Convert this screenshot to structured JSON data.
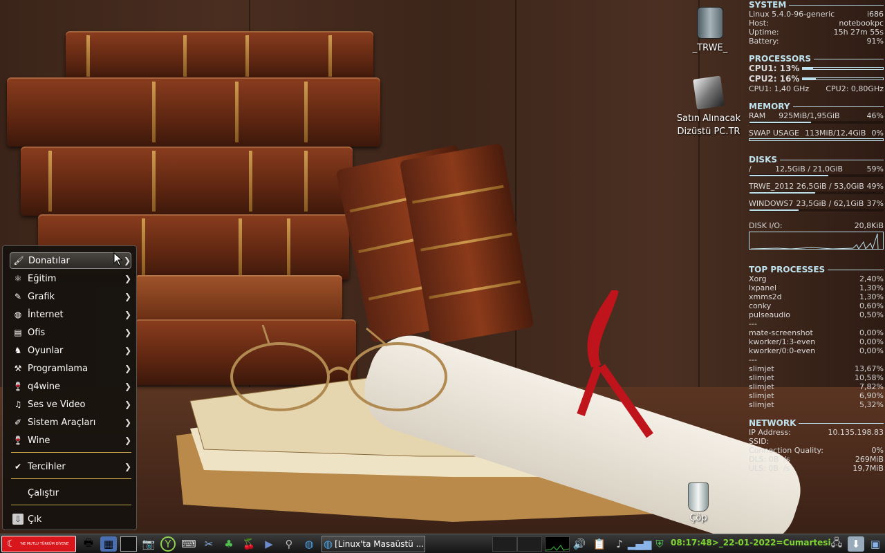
{
  "desktop": {
    "icons": [
      {
        "label": "_TRWE_",
        "icon": "drive-icon"
      },
      {
        "label": "Satın Alınacak\nDizüstü PC.TR",
        "icon": "folder-docs-icon"
      },
      {
        "label": "Çöp",
        "icon": "trash-icon"
      }
    ]
  },
  "conky": {
    "system": {
      "title": "SYSTEM",
      "kernel": "Linux 5.4.0-96-generic",
      "arch": "i686",
      "host_label": "Host:",
      "host": "notebookpc",
      "uptime_label": "Uptime:",
      "uptime": "15h 27m 55s",
      "battery_label": "Battery:",
      "battery": "91%"
    },
    "processors": {
      "title": "PROCESSORS",
      "cpu1": "CPU1: 13%",
      "cpu1_pct": 13,
      "cpu2": "CPU2: 16%",
      "cpu2_pct": 16,
      "freq1": "CPU1: 1,40 GHz",
      "freq2": "CPU2: 0,80GHz"
    },
    "memory": {
      "title": "MEMORY",
      "ram_label": "RAM",
      "ram": "925MiB/1,95GiB",
      "ram_pct_text": "46%",
      "ram_pct": 46,
      "swap_label": "SWAP USAGE",
      "swap": "113MiB/12,4GiB",
      "swap_pct_text": "0%",
      "swap_pct": 0
    },
    "disks": {
      "title": "DISKS",
      "items": [
        {
          "name": "/",
          "usage": "12,5GiB / 21,0GiB",
          "pct_text": "59%",
          "pct": 59
        },
        {
          "name": "TRWE_2012",
          "usage": "26,5GiB / 53,0GiB",
          "pct_text": "49%",
          "pct": 49
        },
        {
          "name": "WINDOWS7",
          "usage": "23,5GiB / 62,1GiB",
          "pct_text": "37%",
          "pct": 37
        }
      ],
      "io_label": "DISK I/O:",
      "io": "20,8KiB"
    },
    "top": {
      "title": "TOP PROCESSES",
      "cpu": [
        {
          "name": "Xorg",
          "val": "2,40%"
        },
        {
          "name": "lxpanel",
          "val": "1,30%"
        },
        {
          "name": "xmms2d",
          "val": "1,30%"
        },
        {
          "name": "conky",
          "val": "0,60%"
        },
        {
          "name": "pulseaudio",
          "val": "0,50%"
        }
      ],
      "sep": "---",
      "io": [
        {
          "name": "mate-screenshot",
          "val": "0,00%"
        },
        {
          "name": "kworker/1:3-even",
          "val": "0,00%"
        },
        {
          "name": "kworker/0:0-even",
          "val": "0,00%"
        }
      ],
      "mem": [
        {
          "name": "slimjet",
          "val": "13,67%"
        },
        {
          "name": "slimjet",
          "val": "10,58%"
        },
        {
          "name": "slimjet",
          "val": "7,82%"
        },
        {
          "name": "slimjet",
          "val": "6,90%"
        },
        {
          "name": "slimjet",
          "val": "5,32%"
        }
      ]
    },
    "network": {
      "title": "NETWORK",
      "ip_label": "IP Address:",
      "ip": "10.135.198.83",
      "ssid_label": "SSID:",
      "ssid": "",
      "quality_label": "Connection Quality:",
      "quality": "0%",
      "dls": "DLS: 0B  /s",
      "dls_total": "269MiB",
      "uls": "ULS: 0B  /s",
      "uls_total": "19,7MiB"
    }
  },
  "menu": {
    "items": [
      {
        "label": "Donatılar",
        "icon": "accessories-icon",
        "arrow": "❯"
      },
      {
        "label": "Eğitim",
        "icon": "education-icon",
        "arrow": "❯"
      },
      {
        "label": "Grafik",
        "icon": "graphics-icon",
        "arrow": "❯"
      },
      {
        "label": "İnternet",
        "icon": "internet-icon",
        "arrow": "❯"
      },
      {
        "label": "Ofis",
        "icon": "office-icon",
        "arrow": "❯"
      },
      {
        "label": "Oyunlar",
        "icon": "games-icon",
        "arrow": "❯"
      },
      {
        "label": "Programlama",
        "icon": "programming-icon",
        "arrow": "❯"
      },
      {
        "label": "q4wine",
        "icon": "wine-glass-icon",
        "arrow": "❯"
      },
      {
        "label": "Ses ve Video",
        "icon": "multimedia-icon",
        "arrow": "❯"
      },
      {
        "label": "Sistem Araçları",
        "icon": "system-tools-icon",
        "arrow": "❯"
      },
      {
        "label": "Wine",
        "icon": "wine-icon",
        "arrow": "❯"
      }
    ],
    "prefs": {
      "label": "Tercihler",
      "icon": "preferences-icon",
      "arrow": "❯"
    },
    "run": {
      "label": "Çalıştır"
    },
    "logout": {
      "label": "Çık",
      "icon": "logout-icon"
    }
  },
  "taskbar": {
    "start_label": "'NE MUTLU TÜRKÜM DİYENE'",
    "quicklaunch": [
      "printer-icon",
      "display-icon",
      "terminal-icon",
      "screenshot-icon",
      "yoono-icon",
      "keyboard-icon",
      "tool-icon",
      "clover-icon",
      "cherry-icon",
      "media-player-icon",
      "antenna-icon",
      "globe-icon"
    ],
    "task_label": "[Linux'ta Masaüstü ...",
    "clock": "08:17:48>_22-01-2022=Cumartesi",
    "tray": [
      "cpu-graph-icon",
      "speaker-icon",
      "clipboard-icon",
      "music-icon",
      "signal-icon",
      "shield-icon"
    ],
    "right": [
      "network-tray-icon",
      "download-icon",
      "windows-icon"
    ]
  },
  "colors": {
    "accent": "#bfe3ee",
    "clock": "#7fd631",
    "start": "#d8161b",
    "menu_sep": "#c8a84a"
  }
}
